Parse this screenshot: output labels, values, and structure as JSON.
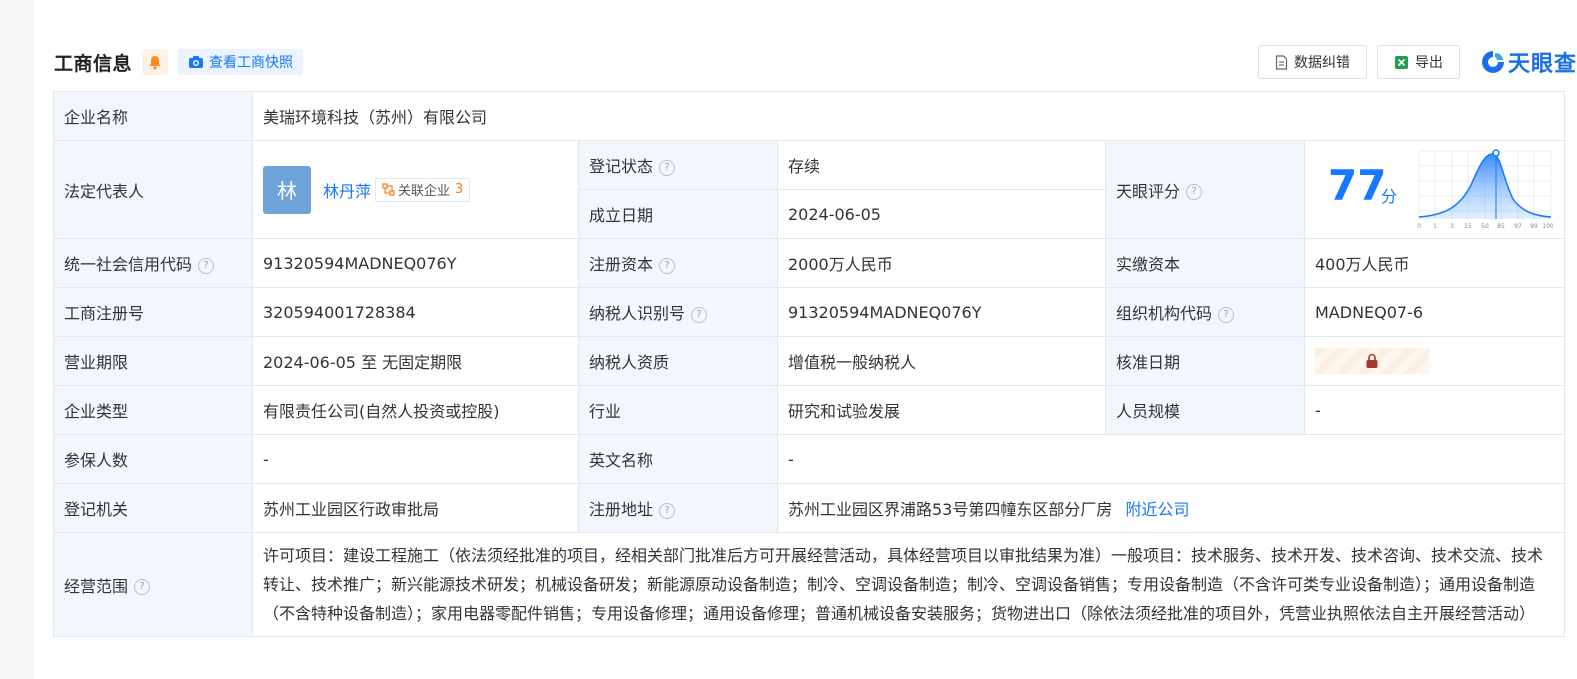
{
  "header": {
    "title": "工商信息",
    "snapshot_label": "查看工商快照",
    "correct_label": "数据纠错",
    "export_label": "导出",
    "brand": "天眼查"
  },
  "rows": {
    "company_name_label": "企业名称",
    "company_name": "美瑞环境科技（苏州）有限公司",
    "legal_rep_label": "法定代表人",
    "legal_rep_avatar": "林",
    "legal_rep_name": "林丹萍",
    "related_label": "关联企业",
    "related_count": "3",
    "reg_status_label": "登记状态",
    "reg_status": "存续",
    "found_date_label": "成立日期",
    "found_date": "2024-06-05",
    "score_label": "天眼评分",
    "score_value": "77",
    "score_unit": "分",
    "score_ticks": [
      "0",
      "1",
      "3",
      "15",
      "50",
      "85",
      "97",
      "99",
      "100"
    ],
    "credit_code_label": "统一社会信用代码",
    "credit_code": "91320594MADNEQ076Y",
    "reg_capital_label": "注册资本",
    "reg_capital": "2000万人民币",
    "paid_capital_label": "实缴资本",
    "paid_capital": "400万人民币",
    "biz_reg_no_label": "工商注册号",
    "biz_reg_no": "320594001728384",
    "taxpayer_id_label": "纳税人识别号",
    "taxpayer_id": "91320594MADNEQ076Y",
    "org_code_label": "组织机构代码",
    "org_code": "MADNEQ07-6",
    "term_label": "营业期限",
    "term": "2024-06-05 至 无固定期限",
    "tax_quality_label": "纳税人资质",
    "tax_quality": "增值税一般纳税人",
    "approve_date_label": "核准日期",
    "type_label": "企业类型",
    "type": "有限责任公司(自然人投资或控股)",
    "industry_label": "行业",
    "industry": "研究和试验发展",
    "staff_label": "人员规模",
    "staff": "-",
    "insured_label": "参保人数",
    "insured": "-",
    "en_name_label": "英文名称",
    "en_name": "-",
    "authority_label": "登记机关",
    "authority": "苏州工业园区行政审批局",
    "address_label": "注册地址",
    "address": "苏州工业园区界浦路53号第四幢东区部分厂房",
    "nearby_label": "附近公司",
    "scope_label": "经营范围",
    "scope": "许可项目：建设工程施工（依法须经批准的项目，经相关部门批准后方可开展经营活动，具体经营项目以审批结果为准）一般项目：技术服务、技术开发、技术咨询、技术交流、技术转让、技术推广；新兴能源技术研发；机械设备研发；新能源原动设备制造；制冷、空调设备制造；制冷、空调设备销售；专用设备制造（不含许可类专业设备制造）；通用设备制造（不含特种设备制造）；家用电器零配件销售；专用设备修理；通用设备修理；普通机械设备安装服务；货物进出口（除依法须经批准的项目外，凭营业执照依法自主开展经营活动）"
  },
  "icons": {
    "bell": "bell-icon",
    "camera": "camera-icon",
    "doc": "doc-icon",
    "excel": "excel-icon",
    "brand": "tianyancha-logo-icon",
    "question": "question-icon",
    "related": "related-icon",
    "lock": "lock-icon"
  },
  "colors": {
    "accent": "#1677ff",
    "label_bg": "#f2f7fe",
    "status_green": "#22a34a",
    "count_orange": "#ff7a1a"
  }
}
